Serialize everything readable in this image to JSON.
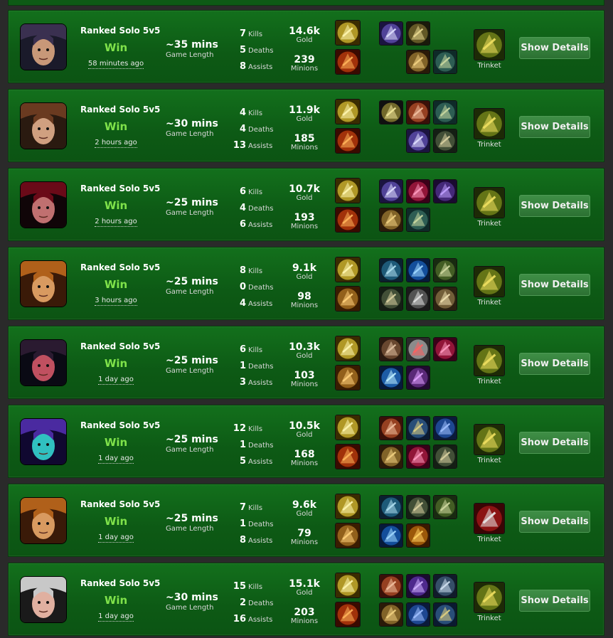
{
  "app": {
    "title": "Match History"
  },
  "colors": {
    "win": "#7fe24a",
    "row_bg": "#0d5a15",
    "button_bg": "#2c7133"
  },
  "labels": {
    "game_length": "Game Length",
    "kills": "Kills",
    "deaths": "Deaths",
    "assists": "Assists",
    "gold": "Gold",
    "minions": "Minions",
    "trinket": "Trinket",
    "details_button": "Show Details"
  },
  "matches": [
    {
      "champion": "champion-portrait-dark-hair",
      "queue": "Ranked Solo 5v5",
      "result": "Win",
      "time_ago": "58 minutes ago",
      "length": "~35 mins",
      "kills": "7",
      "deaths": "5",
      "assists": "8",
      "gold": "14.6k",
      "minions": "239",
      "spells": [
        "flash-spell-icon",
        "ignite-spell-icon"
      ],
      "items": [
        "blade-item-icon",
        "spear-item-icon",
        "",
        "",
        "sword-item-icon",
        "boots-item-icon"
      ],
      "trinket": "warding-totem-icon"
    },
    {
      "champion": "champion-portrait-brown-hair",
      "queue": "Ranked Solo 5v5",
      "result": "Win",
      "time_ago": "2 hours ago",
      "length": "~30 mins",
      "kills": "4",
      "deaths": "4",
      "assists": "13",
      "gold": "11.9k",
      "minions": "185",
      "spells": [
        "flash-spell-icon",
        "ignite-spell-icon"
      ],
      "items": [
        "triforce-item-icon",
        "cleaver-item-icon",
        "boots-item-icon",
        "",
        "blade-item-icon",
        "horn-item-icon"
      ],
      "trinket": "warding-totem-icon"
    },
    {
      "champion": "champion-portrait-red-hood",
      "queue": "Ranked Solo 5v5",
      "result": "Win",
      "time_ago": "2 hours ago",
      "length": "~25 mins",
      "kills": "6",
      "deaths": "4",
      "assists": "6",
      "gold": "10.7k",
      "minions": "193",
      "spells": [
        "flash-spell-icon",
        "ignite-spell-icon"
      ],
      "items": [
        "blade-item-icon",
        "crystal-item-icon",
        "dagger-item-icon",
        "sword-item-icon",
        "boots-item-icon",
        ""
      ],
      "trinket": "warding-totem-icon"
    },
    {
      "champion": "champion-portrait-turban",
      "queue": "Ranked Solo 5v5",
      "result": "Win",
      "time_ago": "3 hours ago",
      "length": "~25 mins",
      "kills": "8",
      "deaths": "0",
      "assists": "4",
      "gold": "9.1k",
      "minions": "98",
      "spells": [
        "flash-spell-icon",
        "exhaust-spell-icon"
      ],
      "items": [
        "eye-item-icon",
        "wave-item-icon",
        "hat-item-icon",
        "horn-item-icon",
        "chest-item-icon",
        "cloak-item-icon"
      ],
      "trinket": "warding-totem-icon"
    },
    {
      "champion": "champion-portrait-red-eyes",
      "queue": "Ranked Solo 5v5",
      "result": "Win",
      "time_ago": "1 day ago",
      "length": "~25 mins",
      "kills": "6",
      "deaths": "1",
      "assists": "3",
      "gold": "10.3k",
      "minions": "103",
      "spells": [
        "flash-spell-icon",
        "exhaust-spell-icon"
      ],
      "items": [
        "gauntlet-item-icon",
        "mask-item-icon",
        "crystal-item-icon",
        "orb-item-icon",
        "wand-item-icon",
        ""
      ],
      "trinket": "warding-totem-icon"
    },
    {
      "champion": "champion-portrait-void",
      "queue": "Ranked Solo 5v5",
      "result": "Win",
      "time_ago": "1 day ago",
      "length": "~25 mins",
      "kills": "12",
      "deaths": "1",
      "assists": "5",
      "gold": "10.5k",
      "minions": "168",
      "spells": [
        "flash-spell-icon",
        "ignite-spell-icon"
      ],
      "items": [
        "cleaver-item-icon",
        "hammer-item-icon",
        "staff-item-icon",
        "sword-item-icon",
        "crystal-item-icon",
        "horn-item-icon"
      ],
      "trinket": "warding-totem-icon"
    },
    {
      "champion": "champion-portrait-turban",
      "queue": "Ranked Solo 5v5",
      "result": "Win",
      "time_ago": "1 day ago",
      "length": "~25 mins",
      "kills": "7",
      "deaths": "1",
      "assists": "8",
      "gold": "9.6k",
      "minions": "79",
      "spells": [
        "flash-spell-icon",
        "exhaust-spell-icon"
      ],
      "items": [
        "eye-item-icon",
        "horn-item-icon",
        "hat-item-icon",
        "wave-item-icon",
        "flame-item-icon",
        ""
      ],
      "trinket": "sweeping-lens-icon"
    },
    {
      "champion": "champion-portrait-white-hair",
      "queue": "Ranked Solo 5v5",
      "result": "Win",
      "time_ago": "1 day ago",
      "length": "~30 mins",
      "kills": "15",
      "deaths": "2",
      "assists": "16",
      "gold": "15.1k",
      "minions": "203",
      "spells": [
        "flash-spell-icon",
        "ignite-spell-icon"
      ],
      "items": [
        "cleaver-item-icon",
        "rune-item-icon",
        "axe-item-icon",
        "sword-item-icon",
        "staff-item-icon",
        "hammer-item-icon"
      ],
      "trinket": "warding-totem-icon"
    }
  ]
}
